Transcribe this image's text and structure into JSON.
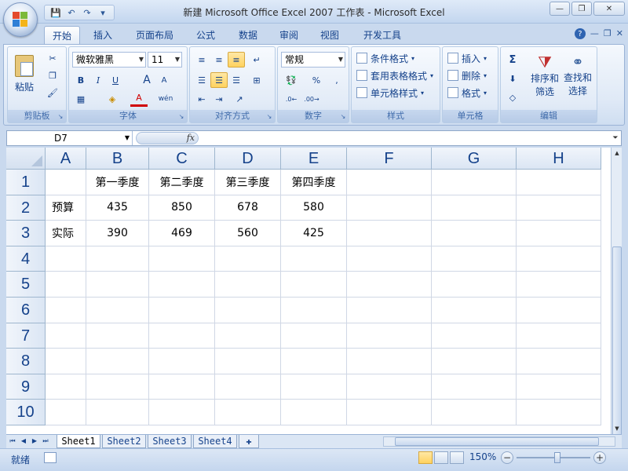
{
  "window": {
    "title": "新建 Microsoft Office Excel 2007 工作表 - Microsoft Excel",
    "min": "—",
    "max": "❐",
    "close": "✕"
  },
  "qat": {
    "save": "💾",
    "undo": "↶",
    "redo": "↷",
    "customize": "▾"
  },
  "tabs": [
    "开始",
    "插入",
    "页面布局",
    "公式",
    "数据",
    "审阅",
    "视图",
    "开发工具"
  ],
  "ribbon": {
    "clipboard": {
      "label": "剪贴板",
      "paste": "粘贴"
    },
    "font": {
      "label": "字体",
      "name": "微软雅黑",
      "size": "11",
      "bold": "B",
      "italic": "I",
      "underline": "U",
      "grow": "A",
      "shrink": "A",
      "color": "A",
      "phonetic": "wén"
    },
    "alignment": {
      "label": "对齐方式"
    },
    "number": {
      "label": "数字",
      "format": "常规",
      "percent": "%",
      "comma": ","
    },
    "styles": {
      "label": "样式",
      "conditional": "条件格式",
      "table": "套用表格格式",
      "cell": "单元格样式"
    },
    "cells": {
      "label": "单元格",
      "insert": "插入",
      "delete": "删除",
      "format": "格式"
    },
    "editing": {
      "label": "编辑",
      "sum": "Σ",
      "sort": "排序和",
      "sort2": "筛选",
      "find": "查找和",
      "find2": "选择"
    }
  },
  "formula_bar": {
    "name_box": "D7",
    "fx": "fx",
    "value": ""
  },
  "columns": [
    "A",
    "B",
    "C",
    "D",
    "E",
    "F",
    "G",
    "H"
  ],
  "rows": [
    "1",
    "2",
    "3",
    "4",
    "5",
    "6",
    "7",
    "8",
    "9",
    "10"
  ],
  "cells": {
    "B1": "第一季度",
    "C1": "第二季度",
    "D1": "第三季度",
    "E1": "第四季度",
    "A2": "预算",
    "B2": "435",
    "C2": "850",
    "D2": "678",
    "E2": "580",
    "A3": "实际",
    "B3": "390",
    "C3": "469",
    "D3": "560",
    "E3": "425"
  },
  "sheets": [
    "Sheet1",
    "Sheet2",
    "Sheet3",
    "Sheet4"
  ],
  "status": {
    "text": "就绪",
    "zoom": "150%"
  }
}
